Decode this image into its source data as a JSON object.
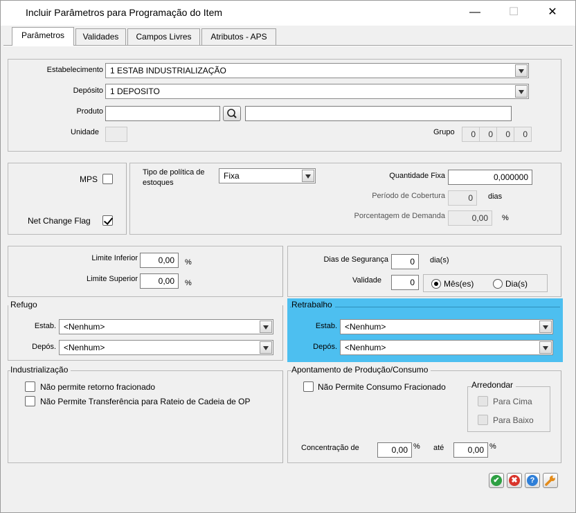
{
  "window": {
    "title": "Incluir Parâmetros para Programação do Item",
    "minimize_glyph": "—",
    "maximize_glyph": "☐",
    "close_glyph": "✕"
  },
  "tabs": [
    {
      "label": "Parâmetros",
      "active": true
    },
    {
      "label": "Validades",
      "active": false
    },
    {
      "label": "Campos Livres",
      "active": false
    },
    {
      "label": "Atributos - APS",
      "active": false
    }
  ],
  "item": {
    "estabelecimento_label": "Estabelecimento",
    "estabelecimento_value": "1 ESTAB INDUSTRIALIZAÇÃO",
    "deposito_label": "Depósito",
    "deposito_value": "1 DEPOSITO",
    "produto_label": "Produto",
    "produto_code": "",
    "produto_desc": "",
    "unidade_label": "Unidade",
    "unidade_value": "",
    "grupo_label": "Grupo",
    "grupo_values": [
      "0",
      "0",
      "0",
      "0"
    ]
  },
  "flags": {
    "mps_label": "MPS",
    "mps_checked": false,
    "net_change_label": "Net Change Flag",
    "net_change_checked": true
  },
  "politica": {
    "tipo_label_1": "Tipo de política de",
    "tipo_label_2": "estoques",
    "tipo_value": "Fixa",
    "qtd_fixa_label": "Quantidade Fixa",
    "qtd_fixa_value": "0,000000",
    "periodo_label": "Período de Cobertura",
    "periodo_value": "0",
    "periodo_unit": "dias",
    "porcentagem_label": "Porcentagem de Demanda",
    "porcentagem_value": "0,00",
    "porcentagem_unit": "%"
  },
  "limites": {
    "inferior_label": "Limite Inferior",
    "inferior_value": "0,00",
    "superior_label": "Limite Superior",
    "superior_value": "0,00",
    "unit": "%"
  },
  "seguranca": {
    "dias_label": "Dias de Segurança",
    "dias_value": "0",
    "dias_unit": "dia(s)",
    "validade_label": "Validade",
    "validade_value": "0",
    "mes_label": "Mês(es)",
    "dia_label": "Dia(s)",
    "selected": "mes"
  },
  "refugo": {
    "title": "Refugo",
    "estab_label": "Estab.",
    "estab_value": "<Nenhum>",
    "depos_label": "Depós.",
    "depos_value": "<Nenhum>"
  },
  "retrabalho": {
    "title": "Retrabalho",
    "estab_label": "Estab.",
    "estab_value": "<Nenhum>",
    "depos_label": "Depós.",
    "depos_value": "<Nenhum>",
    "highlight_color": "#4dbff0"
  },
  "industrializacao": {
    "title": "Industrialização",
    "opt1": "Não permite retorno fracionado",
    "opt2": "Não Permite Transferência para Rateio de Cadeia de OP"
  },
  "apontamento": {
    "title": "Apontamento de Produção/Consumo",
    "consumo_label": "Não Permite Consumo Fracionado",
    "arredondar_title": "Arredondar",
    "para_cima": "Para Cima",
    "para_baixo": "Para Baixo",
    "concentracao_label": "Concentração de",
    "conc_de_value": "0,00",
    "ate_label": "até",
    "conc_ate_value": "0,00",
    "unit": "%"
  },
  "actions": {
    "ok_icon": "check-circle-icon",
    "cancel_icon": "cancel-circle-icon",
    "help_icon": "help-circle-icon",
    "tools_icon": "wrench-icon",
    "ok_color": "#2ea043",
    "cancel_color": "#d9342b",
    "help_color": "#2f7fd8",
    "tools_color": "#e38b1a"
  }
}
